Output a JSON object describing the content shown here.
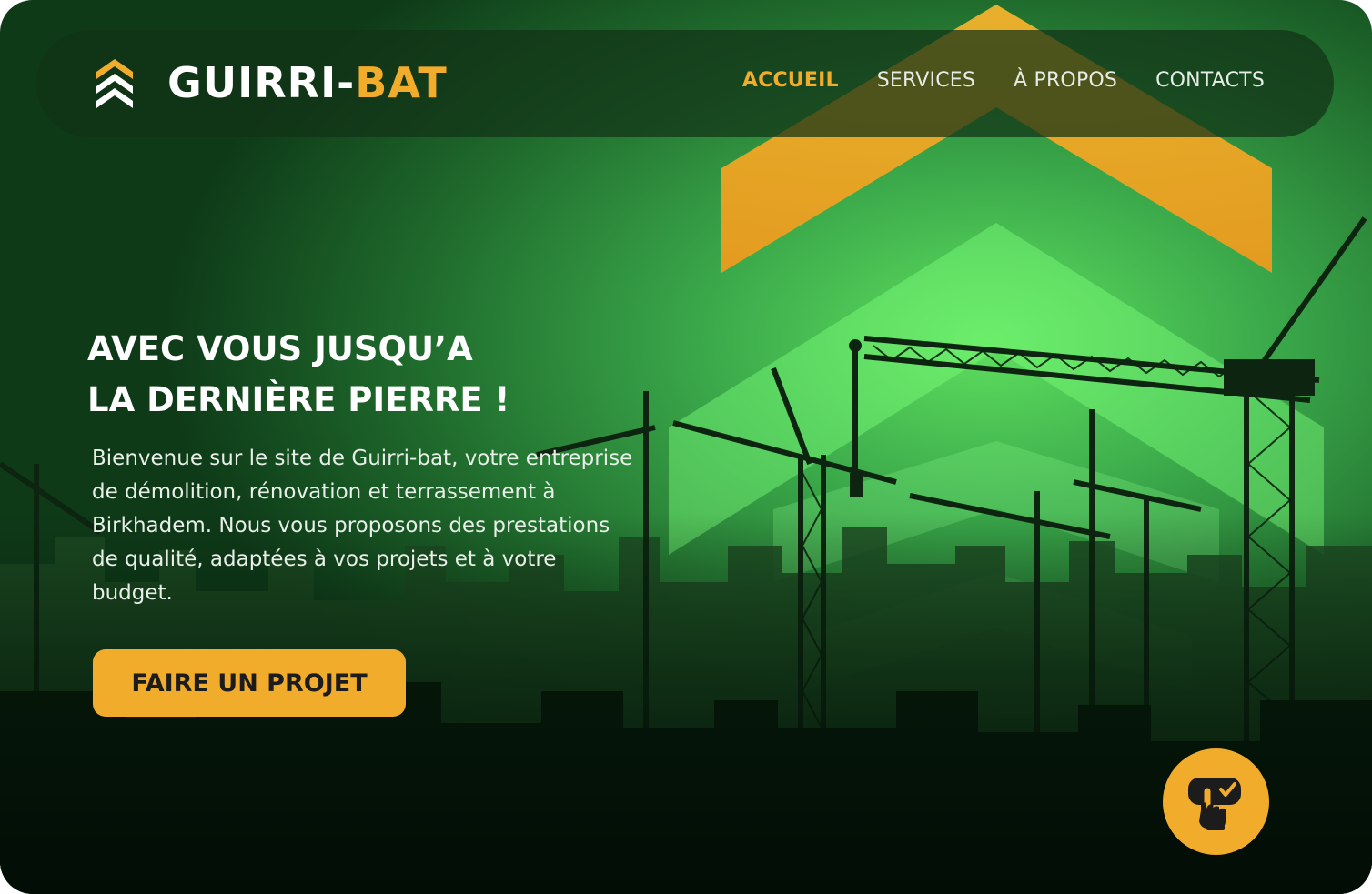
{
  "brand": {
    "name_main": "GUIRRI-",
    "name_accent": "BAT",
    "logo_icon": "chevron-stack-icon",
    "accent_color": "#f2ac2c",
    "bg_color": "#2f8a3c"
  },
  "nav": {
    "items": [
      {
        "label": "ACCUEIL",
        "active": true
      },
      {
        "label": "SERVICES",
        "active": false
      },
      {
        "label": "À PROPOS",
        "active": false
      },
      {
        "label": "CONTACTS",
        "active": false
      }
    ]
  },
  "hero": {
    "title_line1": "AVEC VOUS JUSQU’A",
    "title_line2": "LA DERNIÈRE PIERRE !",
    "description": "Bienvenue sur le site de Guirri-bat, votre entreprise de démolition, rénovation et terrassement à Birkhadem. Nous vous proposons des prestations de qualité, adaptées à vos projets et à votre budget.",
    "cta_label": "FAIRE UN PROJET"
  },
  "floating_button": {
    "icon": "tap-hand-icon"
  }
}
